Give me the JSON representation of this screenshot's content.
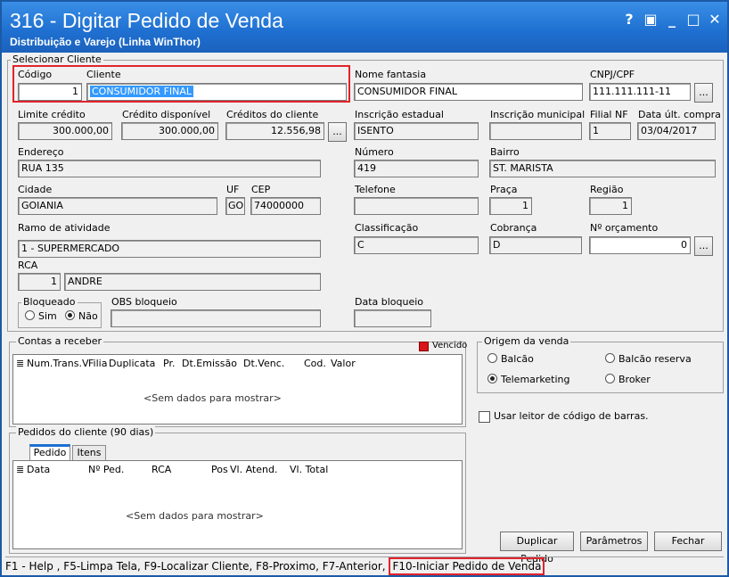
{
  "window": {
    "title": "316 - Digitar Pedido de Venda",
    "subtitle": "Distribuição e Varejo (Linha WinThor)",
    "controls": [
      "?",
      "▣",
      "_",
      "□",
      "✕"
    ]
  },
  "selecionar_cliente": {
    "group_title": "Selecionar Cliente",
    "codigo": {
      "label": "Código",
      "value": "1"
    },
    "cliente": {
      "label": "Cliente",
      "value": "CONSUMIDOR FINAL"
    },
    "nome_fantasia": {
      "label": "Nome fantasia",
      "value": "CONSUMIDOR FINAL"
    },
    "cnpj": {
      "label": "CNPJ/CPF",
      "value": "111.111.111-11"
    },
    "limite_credito": {
      "label": "Limite crédito",
      "value": "300.000,00"
    },
    "credito_disponivel": {
      "label": "Crédito disponível",
      "value": "300.000,00"
    },
    "creditos_cliente": {
      "label": "Créditos do cliente",
      "value": "12.556,98"
    },
    "inscricao_estadual": {
      "label": "Inscrição estadual",
      "value": "ISENTO"
    },
    "inscricao_municipal": {
      "label": "Inscrição municipal",
      "value": ""
    },
    "filial_nf": {
      "label": "Filial NF",
      "value": "1"
    },
    "data_ult_compra": {
      "label": "Data últ. compra",
      "value": "03/04/2017"
    },
    "endereco": {
      "label": "Endereço",
      "value": "RUA 135"
    },
    "numero": {
      "label": "Número",
      "value": "419"
    },
    "bairro": {
      "label": "Bairro",
      "value": "ST. MARISTA"
    },
    "cidade": {
      "label": "Cidade",
      "value": "GOIANIA"
    },
    "uf": {
      "label": "UF",
      "value": "GO"
    },
    "cep": {
      "label": "CEP",
      "value": "74000000"
    },
    "telefone": {
      "label": "Telefone",
      "value": ""
    },
    "praca": {
      "label": "Praça",
      "value": "1"
    },
    "regiao": {
      "label": "Região",
      "value": "1"
    },
    "ramo": {
      "label": "Ramo de atividade",
      "value": "1 - SUPERMERCADO"
    },
    "classificacao": {
      "label": "Classificação",
      "value": "C"
    },
    "cobranca": {
      "label": "Cobrança",
      "value": "D"
    },
    "orcamento": {
      "label": "Nº orçamento",
      "value": "0"
    },
    "rca": {
      "label": "RCA",
      "code": "1",
      "name": "ANDRE"
    },
    "bloqueado": {
      "label": "Bloqueado",
      "sim": "Sim",
      "nao": "Não"
    },
    "obs_bloqueio": {
      "label": "OBS bloqueio",
      "value": ""
    },
    "data_bloqueio": {
      "label": "Data bloqueio",
      "value": ""
    },
    "dots_label": "..."
  },
  "contas_receber": {
    "group_title": "Contas a receber",
    "legend_vencido": "Vencido",
    "columns": [
      "Num.Trans.V",
      "Filia",
      "Duplicata",
      "Pr.",
      "Dt.Emissão",
      "Dt.Venc.",
      "Cod.",
      "Valor"
    ],
    "empty": "<Sem dados para mostrar>"
  },
  "origem_venda": {
    "group_title": "Origem da venda",
    "options": [
      "Balcão",
      "Balcão reserva",
      "Telemarketing",
      "Broker"
    ],
    "selected": "Telemarketing"
  },
  "leitor": {
    "label": "Usar leitor de código de barras."
  },
  "pedidos": {
    "group_title": "Pedidos do cliente (90 dias)",
    "tabs": [
      "Pedido",
      "Itens"
    ],
    "columns": [
      "Data",
      "Nº Ped.",
      "RCA",
      "Pos",
      "Vl. Atend.",
      "Vl. Total"
    ],
    "empty": "<Sem dados para mostrar>"
  },
  "buttons": {
    "duplicar": "Duplicar Pedido",
    "parametros": "Parâmetros",
    "fechar": "Fechar"
  },
  "statusbar": {
    "text": "F1 - Help , F5-Limpa Tela, F9-Localizar Cliente, F8-Proximo, F7-Anterior,",
    "highlight": "F10-Iniciar Pedido de Venda"
  },
  "colors": {
    "title_bar": "#1e6fd0",
    "highlight_border": "#e1232b",
    "vencido": "#d9141b",
    "selection": "#3399ff"
  }
}
